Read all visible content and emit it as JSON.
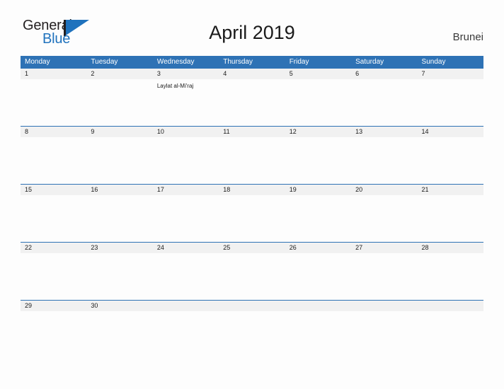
{
  "logo": {
    "text_top": "General",
    "text_bottom": "Blue",
    "mark": "flag-triangle-icon",
    "color_primary": "#1f72bd",
    "color_text": "#231f20"
  },
  "header": {
    "title": "April 2019",
    "country": "Brunei"
  },
  "theme": {
    "header_blue": "#2e72b5",
    "date_band_gray": "#f1f1f1",
    "page_background": "#fdfdfd",
    "text_dark": "#1a1a1a"
  },
  "calendar": {
    "weekday_labels": [
      "Monday",
      "Tuesday",
      "Wednesday",
      "Thursday",
      "Friday",
      "Saturday",
      "Sunday"
    ],
    "weeks": [
      {
        "days": [
          {
            "date": "1",
            "event": ""
          },
          {
            "date": "2",
            "event": ""
          },
          {
            "date": "3",
            "event": "Laylat al-Mi'raj"
          },
          {
            "date": "4",
            "event": ""
          },
          {
            "date": "5",
            "event": ""
          },
          {
            "date": "6",
            "event": ""
          },
          {
            "date": "7",
            "event": ""
          }
        ]
      },
      {
        "days": [
          {
            "date": "8",
            "event": ""
          },
          {
            "date": "9",
            "event": ""
          },
          {
            "date": "10",
            "event": ""
          },
          {
            "date": "11",
            "event": ""
          },
          {
            "date": "12",
            "event": ""
          },
          {
            "date": "13",
            "event": ""
          },
          {
            "date": "14",
            "event": ""
          }
        ]
      },
      {
        "days": [
          {
            "date": "15",
            "event": ""
          },
          {
            "date": "16",
            "event": ""
          },
          {
            "date": "17",
            "event": ""
          },
          {
            "date": "18",
            "event": ""
          },
          {
            "date": "19",
            "event": ""
          },
          {
            "date": "20",
            "event": ""
          },
          {
            "date": "21",
            "event": ""
          }
        ]
      },
      {
        "days": [
          {
            "date": "22",
            "event": ""
          },
          {
            "date": "23",
            "event": ""
          },
          {
            "date": "24",
            "event": ""
          },
          {
            "date": "25",
            "event": ""
          },
          {
            "date": "26",
            "event": ""
          },
          {
            "date": "27",
            "event": ""
          },
          {
            "date": "28",
            "event": ""
          }
        ]
      },
      {
        "days": [
          {
            "date": "29",
            "event": ""
          },
          {
            "date": "30",
            "event": ""
          },
          {
            "date": "",
            "event": ""
          },
          {
            "date": "",
            "event": ""
          },
          {
            "date": "",
            "event": ""
          },
          {
            "date": "",
            "event": ""
          },
          {
            "date": "",
            "event": ""
          }
        ]
      }
    ]
  }
}
